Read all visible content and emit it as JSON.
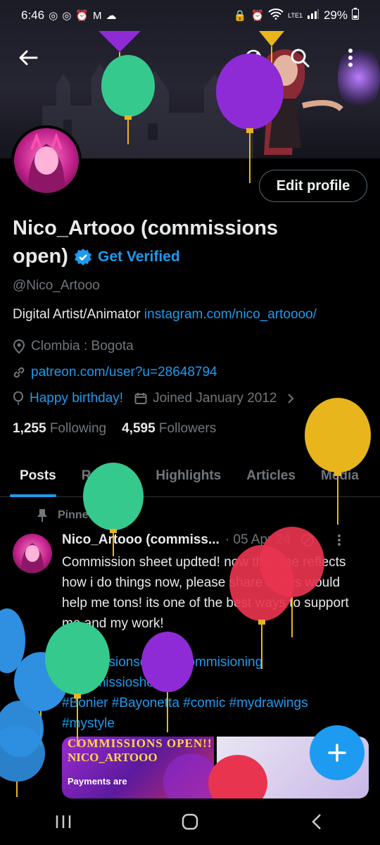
{
  "status_bar": {
    "time": "6:46",
    "battery": "29%",
    "network": "LTE1",
    "left_icons": [
      "instagram-icon",
      "instagram-icon",
      "alarm-icon",
      "gmail-icon",
      "cloud-icon"
    ],
    "right_icons": [
      "lock-icon",
      "alarm-icon",
      "wifi-icon",
      "signal-icon",
      "battery-icon"
    ]
  },
  "header": {
    "back_icon": "arrow-left-icon",
    "actions": [
      "bookmark-icon",
      "search-icon",
      "more-vertical-icon"
    ]
  },
  "profile": {
    "edit_button": "Edit profile",
    "name": "Nico_Artooo (commissions open)",
    "name_line1": "Nico_Artooo (commissions",
    "name_line2": "open)",
    "get_verified": "Get Verified",
    "handle": "@Nico_Artooo",
    "bio_text": "Digital Artist/Animator",
    "bio_link": "instagram.com/nico_artoooo/",
    "location": "Clombia : Bogota",
    "website": "patreon.com/user?u=28648794",
    "birthday": "Happy birthday!",
    "joined": "Joined January 2012",
    "following_count": "1,255",
    "following_label": "Following",
    "followers_count": "4,595",
    "followers_label": "Followers"
  },
  "tabs": [
    "Posts",
    "Replies",
    "Highlights",
    "Articles",
    "Media"
  ],
  "active_tab": "Posts",
  "post": {
    "pinned_label": "Pinned",
    "author": "Nico_Artooo (commiss...",
    "date": "· 05 Apr 24",
    "text": "Commission sheet updted! now this one reflects how i do things now, please share it, this would help me tons! its one of the best ways to support me and my work!",
    "hashtags_line1": "#commisionsopen #commisioning",
    "hashtags_line2": "#commissiosheet",
    "hashtags_line3": "#Bonier #Bayonetta  #comic #mydrawings",
    "hashtags_line4": "#mystyle",
    "media_title": "COMMISSIONS OPEN!!",
    "media_subtitle": "NICO_ARTOOO",
    "media_caption": "Payments are"
  },
  "fab_icon": "plus-icon",
  "nav_bar": [
    "recent-apps-icon",
    "home-icon",
    "back-icon"
  ],
  "colors": {
    "accent": "#1d9bf0",
    "background": "#000000",
    "text": "#e7e9ea",
    "muted": "#71767b",
    "balloon_green": "#35c98e",
    "balloon_purple": "#8e2bd6",
    "balloon_yellow": "#e8b51c",
    "balloon_blue": "#2f8fe0",
    "balloon_red": "#e8344f"
  }
}
